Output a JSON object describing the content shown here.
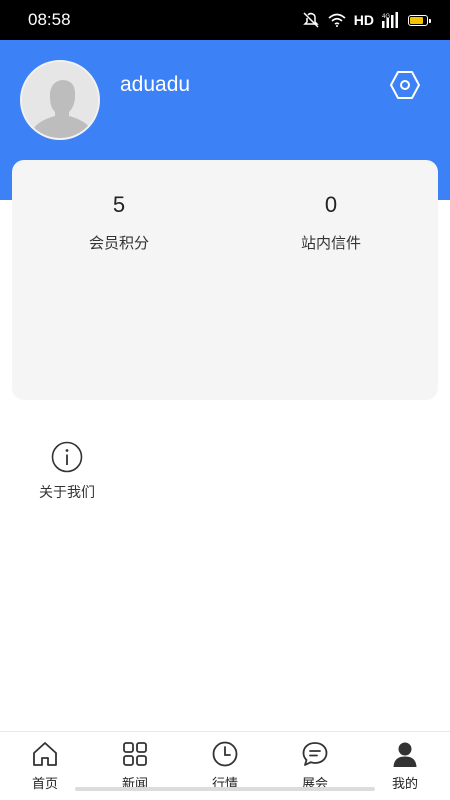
{
  "status_bar": {
    "time": "08:58",
    "network": "HD",
    "signal_tag": "4G",
    "battery_color": "#f5c400"
  },
  "header": {
    "username": "aduadu",
    "accent_color": "#3c82f6"
  },
  "stats": [
    {
      "value": "5",
      "label": "会员积分"
    },
    {
      "value": "0",
      "label": "站内信件"
    }
  ],
  "about": {
    "label": "关于我们",
    "icon": "info-icon"
  },
  "bottom_nav": [
    {
      "label": "首页",
      "icon": "home-icon"
    },
    {
      "label": "新闻",
      "icon": "grid-icon"
    },
    {
      "label": "行情",
      "icon": "clock-icon"
    },
    {
      "label": "展会",
      "icon": "chat-icon"
    },
    {
      "label": "我的",
      "icon": "person-icon"
    }
  ]
}
